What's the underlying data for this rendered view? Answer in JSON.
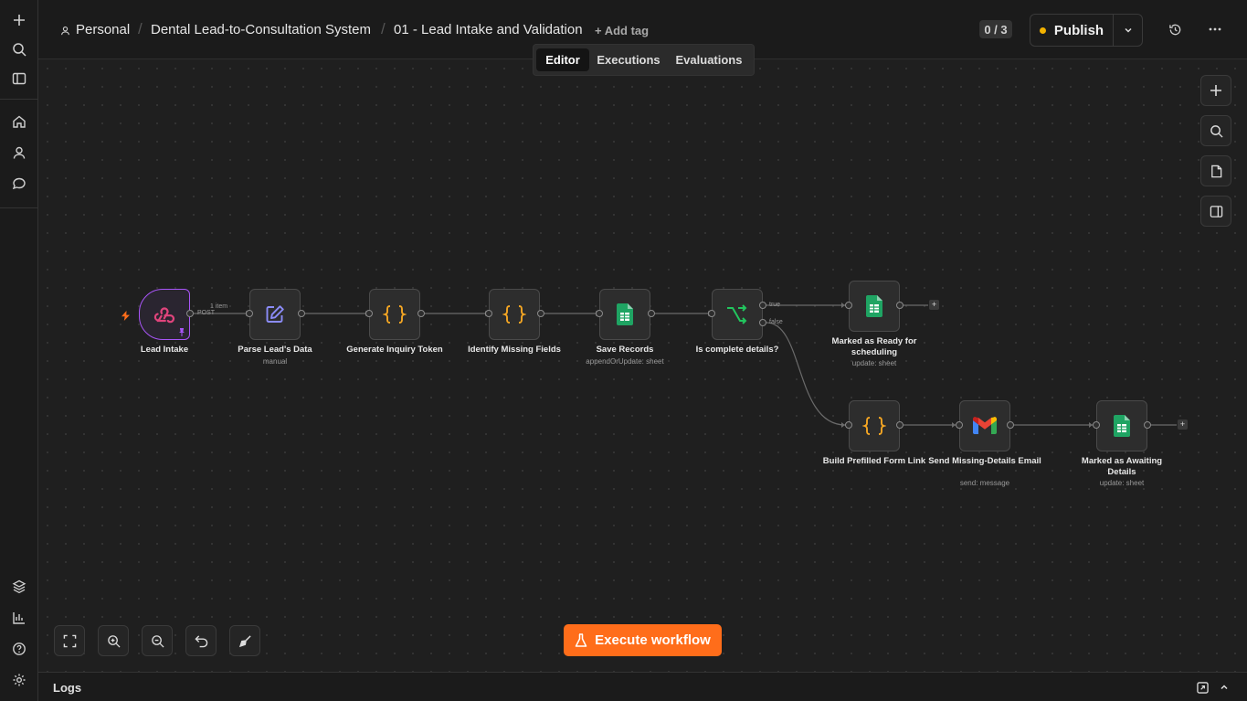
{
  "breadcrumb": {
    "project": "Personal",
    "folder": "Dental Lead-to-Consultation System",
    "workflow": "01 - Lead Intake and Validation",
    "add_tag": "+ Add tag"
  },
  "header": {
    "counter": "0 / 3",
    "publish_label": "Publish"
  },
  "tabs": [
    {
      "label": "Editor",
      "active": true
    },
    {
      "label": "Executions",
      "active": false
    },
    {
      "label": "Evaluations",
      "active": false
    }
  ],
  "nodes": {
    "lead_intake": {
      "label": "Lead Intake",
      "method": "POST"
    },
    "parse_lead": {
      "label": "Parse Lead's Data",
      "subtitle": "manual"
    },
    "generate_token": {
      "label": "Generate Inquiry Token"
    },
    "identify_missing": {
      "label": "Identify Missing Fields"
    },
    "save_records": {
      "label": "Save Records",
      "subtitle": "appendOrUpdate: sheet"
    },
    "is_complete": {
      "label": "Is complete details?",
      "true_label": "true",
      "false_label": "false"
    },
    "marked_ready": {
      "label": "Marked as Ready for scheduling",
      "subtitle": "update: sheet"
    },
    "build_form_link": {
      "label": "Build Prefilled Form Link"
    },
    "send_email": {
      "label": "Send Missing-Details Email",
      "subtitle": "send: message"
    },
    "marked_awaiting": {
      "label": "Marked as Awaiting Details",
      "subtitle": "update: sheet"
    }
  },
  "wire_labels": {
    "items": "1 item"
  },
  "execute_label": "Execute workflow",
  "logs_label": "Logs",
  "colors": {
    "accent": "#ff6d1a",
    "trigger": "#a855f7",
    "sheets": "#1fa463",
    "code": "#f5a623",
    "if": "#22c55e",
    "publish_dot": "#f2b200"
  }
}
